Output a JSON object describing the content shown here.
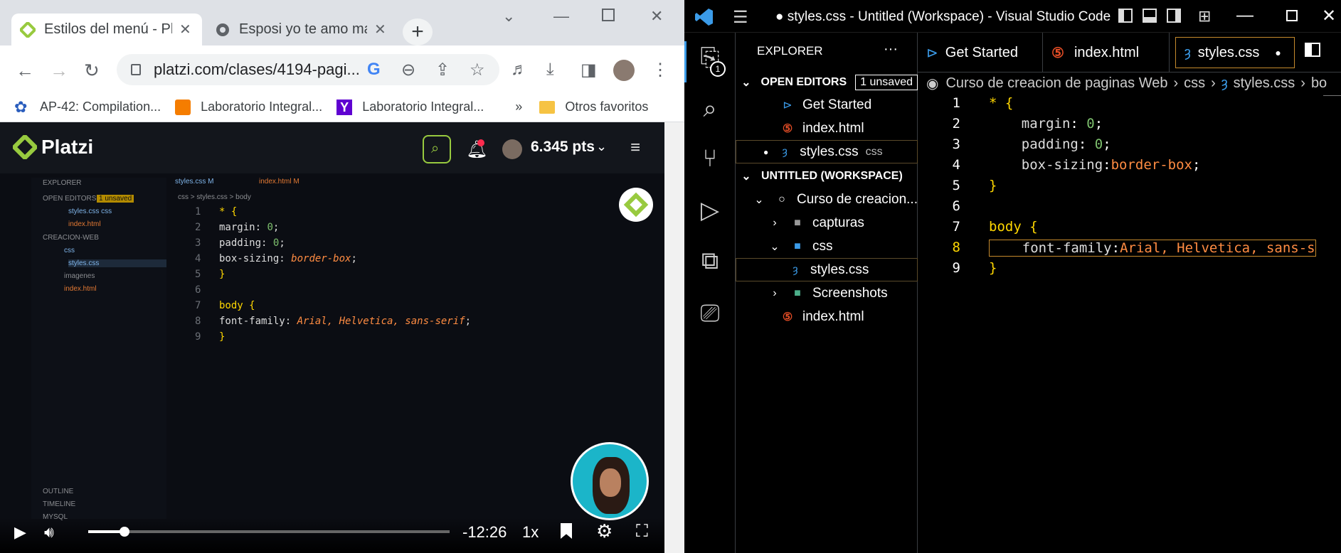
{
  "chrome": {
    "tabs": [
      {
        "title": "Estilos del menú - Plat",
        "active": true
      },
      {
        "title": "Esposi yo te amo mas",
        "active": false
      }
    ],
    "url": "platzi.com/clases/4194-pagi...",
    "bookmarks": [
      {
        "label": "AP-42: Compilation...",
        "icon": "epa-icon"
      },
      {
        "label": "Laboratorio Integral...",
        "icon": "blogger-icon"
      },
      {
        "label": "Laboratorio Integral...",
        "icon": "yahoo-icon"
      }
    ],
    "bookmarks_more": "»",
    "other_bookmarks": "Otros favoritos"
  },
  "platzi": {
    "brand": "Platzi",
    "points": "6.345 pts",
    "video": {
      "time_remaining": "-12:26",
      "speed": "1x",
      "progress": 0.1,
      "inner_editor": {
        "explorer": "EXPLORER",
        "open_editors": "OPEN EDITORS",
        "unsaved": "1 unsaved",
        "files_open": [
          "styles.css  css",
          "index.html"
        ],
        "folder": "CREACION-WEB",
        "tree": [
          "css",
          "styles.css",
          "imagenes",
          "index.html"
        ],
        "outline": [
          "OUTLINE",
          "TIMELINE",
          "MYSQL"
        ],
        "tabs": [
          "styles.css M",
          "index.html M"
        ],
        "crumb": "css > styles.css > body",
        "lines": [
          {
            "n": "1",
            "t": "* {"
          },
          {
            "n": "2",
            "t": "    margin: 0;"
          },
          {
            "n": "3",
            "t": "    padding: 0;"
          },
          {
            "n": "4",
            "t": "    box-sizing: border-box;"
          },
          {
            "n": "5",
            "t": "}"
          },
          {
            "n": "6",
            "t": ""
          },
          {
            "n": "7",
            "t": "body {"
          },
          {
            "n": "8",
            "t": "    font-family: Arial, Helvetica, sans-serif;"
          },
          {
            "n": "9",
            "t": "}"
          }
        ]
      }
    }
  },
  "vscode": {
    "title": "● styles.css - Untitled (Workspace) - Visual Studio Code",
    "explorer": "EXPLORER",
    "explorer_more": "···",
    "source_control_badge": "1",
    "open_editors": "OPEN EDITORS",
    "unsaved_badge": "1 unsaved",
    "open_files": [
      {
        "name": "Get Started",
        "icon": "vscode-icon",
        "dirty": false,
        "hint": ""
      },
      {
        "name": "index.html",
        "icon": "html-icon",
        "dirty": false,
        "hint": ""
      },
      {
        "name": "styles.css",
        "icon": "css-icon",
        "dirty": true,
        "hint": "css"
      }
    ],
    "workspace": "UNTITLED (WORKSPACE)",
    "tree": [
      {
        "name": "Curso de creacion...",
        "type": "root",
        "expanded": true
      },
      {
        "name": "capturas",
        "type": "folder",
        "expanded": false
      },
      {
        "name": "css",
        "type": "folder-open",
        "expanded": true
      },
      {
        "name": "styles.css",
        "type": "css-file",
        "selected": true
      },
      {
        "name": "Screenshots",
        "type": "folder-special",
        "expanded": false
      },
      {
        "name": "index.html",
        "type": "html-file"
      }
    ],
    "editor_tabs": [
      {
        "name": "Get Started",
        "icon": "vscode-icon",
        "active": false
      },
      {
        "name": "index.html",
        "icon": "html-icon",
        "active": false
      },
      {
        "name": "styles.css",
        "icon": "css-icon",
        "active": true,
        "dirty": true
      }
    ],
    "breadcrumb": [
      "Curso de creacion de paginas Web",
      "css",
      "styles.css",
      "bo"
    ],
    "code": [
      {
        "n": "1",
        "t": "* {"
      },
      {
        "n": "2",
        "t": "    margin: 0;"
      },
      {
        "n": "3",
        "t": "    padding: 0;"
      },
      {
        "n": "4",
        "t": "    box-sizing:border-box;"
      },
      {
        "n": "5",
        "t": "}"
      },
      {
        "n": "6",
        "t": ""
      },
      {
        "n": "7",
        "t": "body {"
      },
      {
        "n": "8",
        "t": "    font-family:Arial, Helvetica, sans-s"
      },
      {
        "n": "9",
        "t": "}"
      }
    ],
    "active_line": "8"
  }
}
